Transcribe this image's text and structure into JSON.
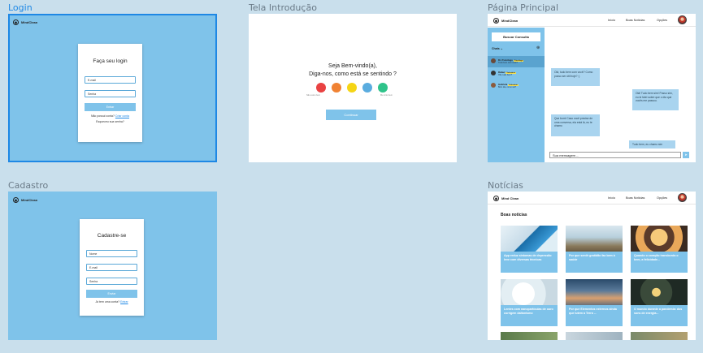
{
  "frames": {
    "login": "Login",
    "intro": "Tela Introdução",
    "main": "Página Principal",
    "signup": "Cadastro",
    "news": "Notícias"
  },
  "brand": "MindClean",
  "brand_alt": "Mind Clean",
  "login": {
    "title": "Faça seu login",
    "email": "E-mail",
    "password": "Senha",
    "button": "Entrar",
    "no_account": "Não possui conta?",
    "create_link": "Criar conta",
    "forgot": "Esqueceu sua senha?"
  },
  "signup": {
    "title": "Cadastre-se",
    "name": "Nome",
    "email": "E-mail",
    "password": "Senha",
    "button": "Enviar",
    "has_account": "Já tem uma conta?",
    "login_link": "Entrar"
  },
  "intro": {
    "line1": "Seja Bem-vindo(a),",
    "line2": "Diga-nos, como está se sentindo ?",
    "left_note": "Não estou bem",
    "right_note": "Me sinto bem",
    "button": "Continuar",
    "mood_colors": [
      "#e94242",
      "#f08233",
      "#f5d515",
      "#5aacdf",
      "#2fc38a"
    ]
  },
  "nav": {
    "inicio": "Início",
    "boas": "Boas Notícias",
    "opcoes": "Opções"
  },
  "main": {
    "search_btn": "Buscar Consulta",
    "chats_label": "Chats",
    "chats": [
      {
        "name": "Dr. Psicólogo",
        "tag": "Psicólogo",
        "msg": "Tudo bem com você?"
      },
      {
        "name": "Rafael",
        "tag": "Voluntário",
        "msg": "Olá, tudo bem?"
      },
      {
        "name": "Gabriela",
        "tag": "Voluntária",
        "msg": "Bom dia, como vai?"
      }
    ],
    "messages": [
      "Olá, tudo bem com você? Como posso ser útil hoje? :)",
      "Olá! Tudo bem sim! Posso sim, eu te falei sobre que o dia que vocês me passou.",
      "Que bom! Caso você precise de uma conversa, ela está lá, eu te chamo",
      "Tudo bem, eu chamo sim"
    ],
    "input_placeholder": "Sua mensagem ...",
    "send": "➤"
  },
  "news": {
    "title": "Boas notícias",
    "items": [
      "App reduz sintomas de depressão leve com diversas técnicas",
      "Por que sentir gratidão faz bem à saúde",
      "Quando o coração transborda o bem, a felicidade...",
      "Lentes com nanopartículas de ouro corrigem daltonismo",
      "Por que Elementos externos ainda que lutem a Terra ...",
      "O mundo durante a pandemia: dos sons de energia..."
    ]
  }
}
